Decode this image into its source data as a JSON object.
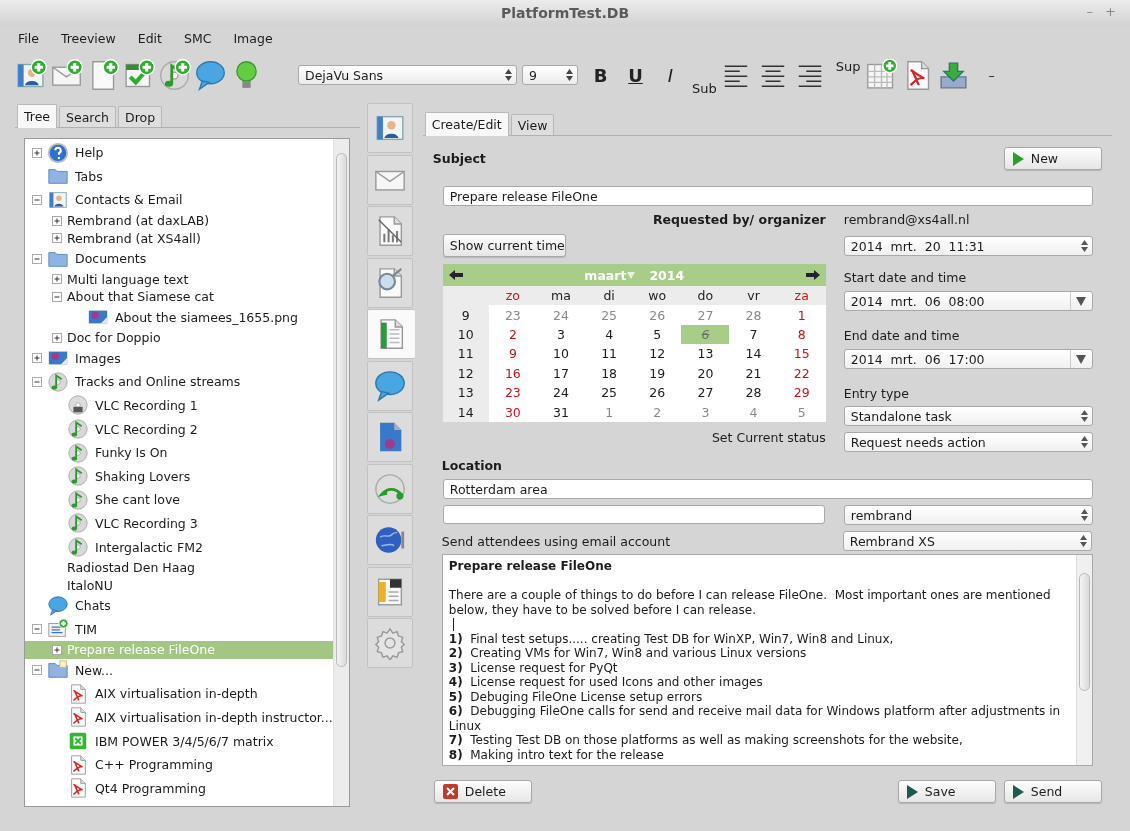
{
  "window": {
    "title": "PlatformTest.DB",
    "controls": [
      "–",
      "+"
    ]
  },
  "menu": [
    "File",
    "Treeview",
    "Edit",
    "SMC",
    "Image"
  ],
  "toolbar": [
    {
      "kind": "contact-add"
    },
    {
      "kind": "mail-add"
    },
    {
      "kind": "document-add"
    },
    {
      "kind": "task-add"
    },
    {
      "kind": "music-add"
    },
    {
      "kind": "chat"
    },
    {
      "kind": "bulb"
    },
    {
      "kind": "font",
      "value": "DejaVu Sans"
    },
    {
      "kind": "size",
      "value": "9"
    },
    {
      "kind": "bold",
      "label": "B"
    },
    {
      "kind": "underline",
      "label": "U"
    },
    {
      "kind": "italic",
      "label": "I"
    },
    {
      "kind": "sub",
      "label": "Sub"
    },
    {
      "kind": "align-left"
    },
    {
      "kind": "align-center"
    },
    {
      "kind": "align-right"
    },
    {
      "kind": "sup",
      "label": "Sup"
    },
    {
      "kind": "calendar-add"
    },
    {
      "kind": "pdf"
    },
    {
      "kind": "import"
    },
    {
      "kind": "text",
      "label": "–"
    }
  ],
  "left_tabs": [
    {
      "label": "Tree",
      "selected": true
    },
    {
      "label": "Search",
      "selected": false
    },
    {
      "label": "Drop",
      "selected": false
    }
  ],
  "tree": {
    "items": [
      {
        "label": "Help",
        "kind": "help",
        "expanded": false,
        "selected": false
      },
      {
        "label": "Tabs",
        "kind": "folder",
        "selected": false
      },
      {
        "label": "Contacts & Email",
        "kind": "contact",
        "expanded": true,
        "selected": false,
        "children": [
          {
            "label": "Rembrand (at daxLAB)",
            "expanded": false,
            "selected": false
          },
          {
            "label": "Rembrand (at XS4all)",
            "expanded": false,
            "selected": false
          }
        ]
      },
      {
        "label": "Documents",
        "kind": "folder",
        "expanded": true,
        "selected": false,
        "children": [
          {
            "label": "Multi language text",
            "expanded": false,
            "selected": false
          },
          {
            "label": "About that Siamese cat",
            "expanded": true,
            "selected": false,
            "children": [
              {
                "label": "About the siamees_1655.png",
                "kind": "image",
                "selected": false
              }
            ]
          },
          {
            "label": "Doc for Doppio",
            "expanded": false,
            "selected": false
          }
        ]
      },
      {
        "label": "Images",
        "kind": "image",
        "expanded": false,
        "selected": false
      },
      {
        "label": "Tracks and Online streams",
        "kind": "music",
        "expanded": true,
        "selected": false,
        "children": [
          {
            "label": "VLC Recording 1",
            "kind": "disc",
            "selected": false
          },
          {
            "label": "VLC Recording 2",
            "kind": "music",
            "selected": false
          },
          {
            "label": "Funky Is On",
            "kind": "music",
            "selected": false
          },
          {
            "label": "Shaking Lovers",
            "kind": "music",
            "selected": false
          },
          {
            "label": "She cant love",
            "kind": "music",
            "selected": false
          },
          {
            "label": "VLC Recording 3",
            "kind": "music",
            "selected": false
          },
          {
            "label": "Intergalactic FM2",
            "kind": "music",
            "selected": false
          },
          {
            "label": "Radiostad Den Haag",
            "selected": false
          },
          {
            "label": "ItaloNU",
            "selected": false
          }
        ]
      },
      {
        "label": "Chats",
        "kind": "chat",
        "selected": false
      },
      {
        "label": "TIM",
        "kind": "tim",
        "expanded": true,
        "selected": false,
        "children": [
          {
            "label": "Prepare release FileOne",
            "expanded": false,
            "selected": true
          }
        ]
      },
      {
        "label": "New...",
        "kind": "folder-new",
        "expanded": true,
        "selected": false,
        "children": [
          {
            "label": "AIX virtualisation in-depth",
            "kind": "pdf",
            "selected": false
          },
          {
            "label": "AIX virtualisation in-depth instructor...",
            "kind": "pdf",
            "selected": false
          },
          {
            "label": "IBM POWER 3/4/5/6/7 matrix",
            "kind": "sheet",
            "selected": false
          },
          {
            "label": "C++ Programming",
            "kind": "pdf",
            "selected": false
          },
          {
            "label": "Qt4 Programming",
            "kind": "pdf",
            "selected": false
          }
        ]
      }
    ]
  },
  "side_tools": [
    {
      "kind": "contact",
      "selected": false
    },
    {
      "kind": "mail",
      "selected": false
    },
    {
      "kind": "chart",
      "selected": false
    },
    {
      "kind": "search",
      "selected": false
    },
    {
      "kind": "sheet",
      "selected": true
    },
    {
      "kind": "chat",
      "selected": false
    },
    {
      "kind": "image",
      "selected": false
    },
    {
      "kind": "disc",
      "selected": false
    },
    {
      "kind": "globe",
      "selected": false
    },
    {
      "kind": "notes",
      "selected": false
    },
    {
      "kind": "gear",
      "selected": false
    }
  ],
  "edit_tabs": [
    {
      "label": "Create/Edit",
      "selected": true
    },
    {
      "label": "View",
      "selected": false
    }
  ],
  "form": {
    "subject_label": "Subject",
    "new_button": "New",
    "subject": "Prepare release FileOne",
    "organizer_label": "Requested by/ organizer",
    "organizer": "rembrand@xs4all.nl",
    "show_time_button": "Show current time",
    "current_time": "2014  mrt.  20  11:31",
    "calendar": {
      "month": "maart",
      "year": "2014",
      "weekdays": [
        {
          "label": "zo",
          "weekend": true
        },
        {
          "label": "ma",
          "weekend": false
        },
        {
          "label": "di",
          "weekend": false
        },
        {
          "label": "wo",
          "weekend": false
        },
        {
          "label": "do",
          "weekend": false
        },
        {
          "label": "vr",
          "weekend": false
        },
        {
          "label": "za",
          "weekend": true
        }
      ],
      "weeks": [
        {
          "number": "9",
          "days": [
            {
              "text": "23",
              "outside": true,
              "selected": false
            },
            {
              "text": "24",
              "outside": true,
              "selected": false
            },
            {
              "text": "25",
              "outside": true,
              "selected": false
            },
            {
              "text": "26",
              "outside": true,
              "selected": false
            },
            {
              "text": "27",
              "outside": true,
              "selected": false
            },
            {
              "text": "28",
              "outside": true,
              "selected": false
            },
            {
              "text": "1",
              "outside": false,
              "selected": false
            }
          ]
        },
        {
          "number": "10",
          "days": [
            {
              "text": "2",
              "outside": false,
              "selected": false
            },
            {
              "text": "3",
              "outside": false,
              "selected": false
            },
            {
              "text": "4",
              "outside": false,
              "selected": false
            },
            {
              "text": "5",
              "outside": false,
              "selected": false
            },
            {
              "text": "6",
              "outside": false,
              "selected": true
            },
            {
              "text": "7",
              "outside": false,
              "selected": false
            },
            {
              "text": "8",
              "outside": false,
              "selected": false
            }
          ]
        },
        {
          "number": "11",
          "days": [
            {
              "text": "9",
              "outside": false,
              "selected": false
            },
            {
              "text": "10",
              "outside": false,
              "selected": false
            },
            {
              "text": "11",
              "outside": false,
              "selected": false
            },
            {
              "text": "12",
              "outside": false,
              "selected": false
            },
            {
              "text": "13",
              "outside": false,
              "selected": false
            },
            {
              "text": "14",
              "outside": false,
              "selected": false
            },
            {
              "text": "15",
              "outside": false,
              "selected": false
            }
          ]
        },
        {
          "number": "12",
          "days": [
            {
              "text": "16",
              "outside": false,
              "selected": false
            },
            {
              "text": "17",
              "outside": false,
              "selected": false
            },
            {
              "text": "18",
              "outside": false,
              "selected": false
            },
            {
              "text": "19",
              "outside": false,
              "selected": false
            },
            {
              "text": "20",
              "outside": false,
              "selected": false
            },
            {
              "text": "21",
              "outside": false,
              "selected": false
            },
            {
              "text": "22",
              "outside": false,
              "selected": false
            }
          ]
        },
        {
          "number": "13",
          "days": [
            {
              "text": "23",
              "outside": false,
              "selected": false
            },
            {
              "text": "24",
              "outside": false,
              "selected": false
            },
            {
              "text": "25",
              "outside": false,
              "selected": false
            },
            {
              "text": "26",
              "outside": false,
              "selected": false
            },
            {
              "text": "27",
              "outside": false,
              "selected": false
            },
            {
              "text": "28",
              "outside": false,
              "selected": false
            },
            {
              "text": "29",
              "outside": false,
              "selected": false
            }
          ]
        },
        {
          "number": "14",
          "days": [
            {
              "text": "30",
              "outside": false,
              "selected": false
            },
            {
              "text": "31",
              "outside": false,
              "selected": false
            },
            {
              "text": "1",
              "outside": true,
              "selected": false
            },
            {
              "text": "2",
              "outside": true,
              "selected": false
            },
            {
              "text": "3",
              "outside": true,
              "selected": false
            },
            {
              "text": "4",
              "outside": true,
              "selected": false
            },
            {
              "text": "5",
              "outside": true,
              "selected": false
            }
          ]
        }
      ]
    },
    "start_label": "Start date and time",
    "start": "2014  mrt.  06  08:00",
    "end_label": "End date and time",
    "end": "2014  mrt.  06  17:00",
    "entry_type_label": "Entry type",
    "entry_type": "Standalone task",
    "status_label": "Set Current status",
    "status": "Request needs action",
    "location_label": "Location",
    "location": "Rotterdam area",
    "attendee": "rembrand",
    "account_label": "Send attendees using email account",
    "account": "Rembrand XS",
    "notes": {
      "title": "Prepare release FileOne",
      "paragraph": "There are a couple of things to do before I can release FileOne.  Most important ones are mentioned below, they have to be solved before I can release.",
      "items": [
        {
          "number": "1)",
          "text": "Final test setups..... creating Test DB for WinXP, Win7, Win8 and Linux,"
        },
        {
          "number": "2)",
          "text": "Creating VMs for Win7, Win8 and various Linux versions"
        },
        {
          "number": "3)",
          "text": "License request for PyQt"
        },
        {
          "number": "4)",
          "text": "License request for used Icons and other images"
        },
        {
          "number": "5)",
          "text": "Debuging FileOne License setup errors"
        },
        {
          "number": "6)",
          "text": "Debugging FileOne calls for send and receive mail data for Windows platform after adjustments in Linux"
        },
        {
          "number": "7)",
          "text": "Testing Test DB on those platforms as well as making screenshots for the website,"
        },
        {
          "number": "8)",
          "text": "Making intro text for the release"
        }
      ]
    },
    "actions": [
      {
        "label": "Delete",
        "kind": "delete"
      },
      {
        "label": "Save",
        "kind": "save"
      },
      {
        "label": "Send",
        "kind": "send"
      }
    ]
  }
}
